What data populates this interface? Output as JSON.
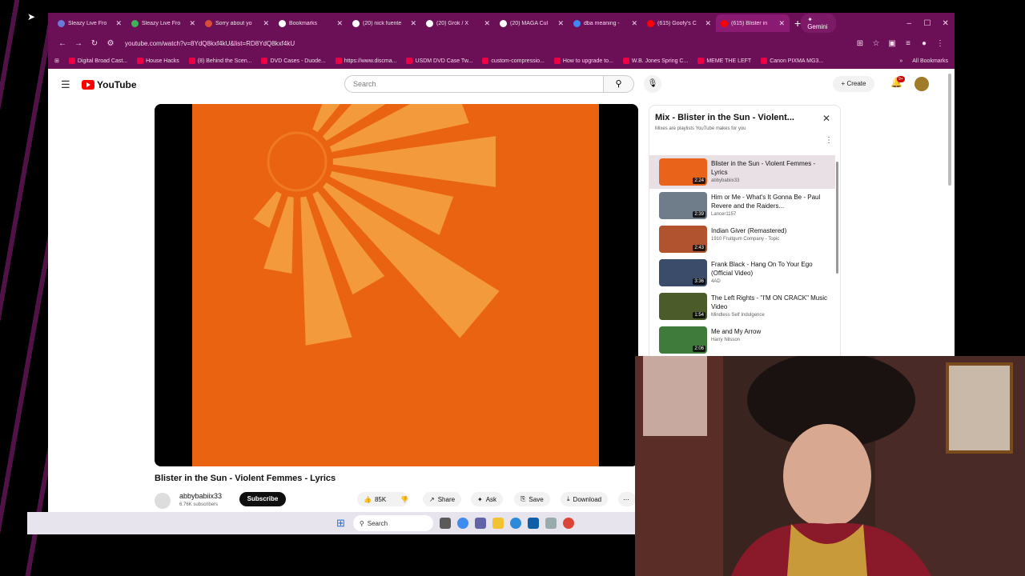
{
  "browser": {
    "tabs": [
      {
        "label": "Sleazy Live Fro",
        "color": "#6b7bd8"
      },
      {
        "label": "Sleazy Live Fro",
        "color": "#3fb35a"
      },
      {
        "label": "Sorry about yo",
        "color": "#d94c3a"
      },
      {
        "label": "Bookmarks",
        "color": "#ffffff"
      },
      {
        "label": "(20) nick fuente",
        "color": "#ffffff"
      },
      {
        "label": "(20) Grok / X",
        "color": "#ffffff"
      },
      {
        "label": "(20) MAGA Cul",
        "color": "#ffffff"
      },
      {
        "label": "dba meaning -",
        "color": "#4285f4"
      },
      {
        "label": "(615) Goofy's C",
        "color": "#ff0000"
      },
      {
        "label": "(615) Blister in",
        "color": "#ff0000",
        "active": true
      }
    ],
    "gemini_label": "Gemini",
    "url": "youtube.com/watch?v=8YdQ8kxf4kU&list=RD8YdQ8kxf4kU",
    "bookmarks": [
      "Digital Broad Cast...",
      "House Hacks",
      "(8) Behind the Scen...",
      "DVD Cases - Duode...",
      "https://www.discma...",
      "USDM DVD Case Tw...",
      "custom-compressio...",
      "How to upgrade to...",
      "W.B. Jones Spring C...",
      "MEME THE LEFT",
      "Canon PIXMA MG3..."
    ],
    "all_bookmarks": "All Bookmarks"
  },
  "youtube": {
    "logo": "YouTube",
    "search_placeholder": "Search",
    "create_label": "Create",
    "notif_count": "9+",
    "video_title": "Blister in the Sun - Violent Femmes - Lyrics",
    "channel": "abbybabiix33",
    "subscribers": "6.76K subscribers",
    "subscribe_label": "Subscribe",
    "likes": "85K",
    "share_label": "Share",
    "ask_label": "Ask",
    "save_label": "Save",
    "download_label": "Download"
  },
  "playlist": {
    "title": "Mix - Blister in the Sun - Violent...",
    "subtitle": "Mixes are playlists YouTube makes for you",
    "items": [
      {
        "title": "Blister in the Sun - Violent Femmes - Lyrics",
        "channel": "abbybabiix33",
        "duration": "2:24",
        "color": "#e9641a"
      },
      {
        "title": "Him or Me - What's It Gonna Be - Paul Revere and the Raiders...",
        "channel": "Lancer1157",
        "duration": "2:39",
        "color": "#6f7d8a"
      },
      {
        "title": "Indian Giver (Remastered)",
        "channel": "1910 Fruitgum Company - Topic",
        "duration": "2:43",
        "color": "#b0532e"
      },
      {
        "title": "Frank Black - Hang On To Your Ego (Official Video)",
        "channel": "4AD",
        "duration": "3:36",
        "color": "#3b4b6a"
      },
      {
        "title": "The Left Rights - \"I'M ON CRACK\" Music Video",
        "channel": "Mindless Self Indulgence",
        "duration": "1:54",
        "color": "#4b5b2a"
      },
      {
        "title": "Me and My Arrow",
        "channel": "Harry Nilsson",
        "duration": "2:06",
        "color": "#3f7b3a"
      }
    ]
  },
  "taskbar": {
    "search_label": "Search"
  }
}
